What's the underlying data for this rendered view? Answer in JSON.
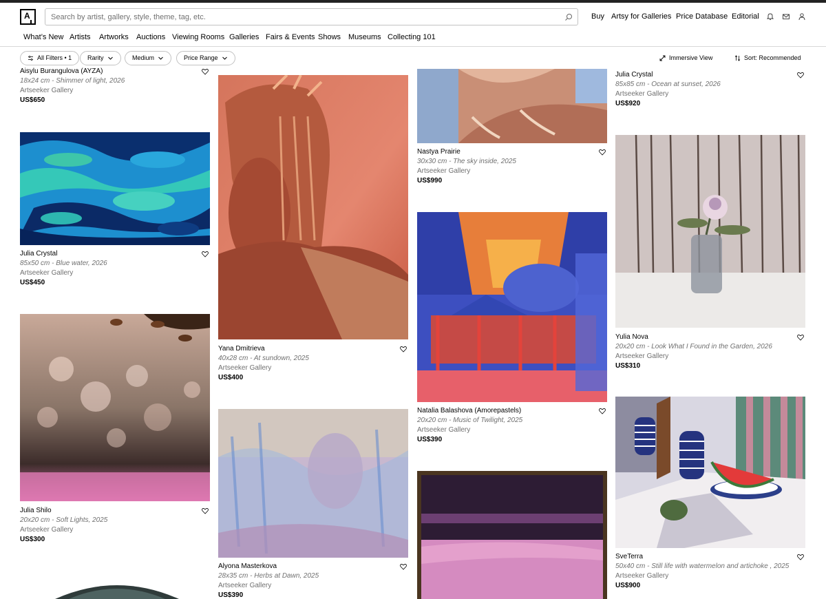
{
  "header": {
    "logo_letter": "A",
    "search_placeholder": "Search by artist, gallery, style, theme, tag, etc.",
    "links": {
      "buy": "Buy",
      "artsy_galleries": "Artsy for Galleries",
      "price_db": "Price Database",
      "editorial": "Editorial"
    }
  },
  "nav": [
    "What’s New",
    "Artists",
    "Artworks",
    "Auctions",
    "Viewing Rooms",
    "Galleries",
    "Fairs & Events",
    "Shows",
    "Museums",
    "Collecting 101"
  ],
  "filters": {
    "all_filters": "All Filters • 1",
    "rarity": "Rarity",
    "medium": "Medium",
    "price_range": "Price Range",
    "immersive": "Immersive View",
    "sort": "Sort: Recommended"
  },
  "artworks": [
    {
      "artist": "Aisylu Burangulova (AYZA)",
      "title": "18x24 cm - Shimmer of light, 2026",
      "gallery": "Artseeker Gallery",
      "price": "US$650"
    },
    {
      "artist": "Julia Crystal",
      "title": "85x50 cm - Blue water, 2026",
      "gallery": "Artseeker Gallery",
      "price": "US$450"
    },
    {
      "artist": "Julia Shilo",
      "title": "20x20 cm - Soft Lights, 2025",
      "gallery": "Artseeker Gallery",
      "price": "US$300"
    },
    {
      "artist": "Yana Dmitrieva",
      "title": "40x28 cm - At sundown, 2025",
      "gallery": "Artseeker Gallery",
      "price": "US$400"
    },
    {
      "artist": "Alyona Masterkova",
      "title": "28x35 cm - Herbs at Dawn, 2025",
      "gallery": "Artseeker Gallery",
      "price": "US$390"
    },
    {
      "artist": "Nastya Prairie",
      "title": "30x30 cm - The sky inside, 2025",
      "gallery": "Artseeker Gallery",
      "price": "US$990"
    },
    {
      "artist": "Natalia Balashova (Amorepastels)",
      "title": "20x20 cm - Music of Twilight, 2025",
      "gallery": "Artseeker Gallery",
      "price": "US$390"
    },
    {
      "artist": "Julia Crystal",
      "title": "85x85 cm - Ocean at sunset, 2026",
      "gallery": "Artseeker Gallery",
      "price": "US$920"
    },
    {
      "artist": "Yulia Nova",
      "title": "20x20 cm - Look What I Found in the Garden, 2026",
      "gallery": "Artseeker Gallery",
      "price": "US$310"
    },
    {
      "artist": "SveTerra",
      "title": "50x40 cm - Still life with watermelon and artichoke , 2025",
      "gallery": "Artseeker Gallery",
      "price": "US$900"
    }
  ]
}
